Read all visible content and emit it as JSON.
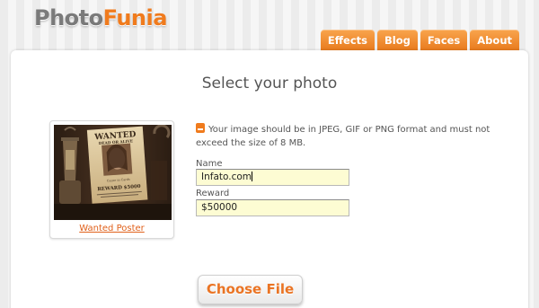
{
  "header": {
    "logo_part1": "Photo",
    "logo_part2": "Funia",
    "nav": [
      "Effects",
      "Blog",
      "Faces",
      "About"
    ]
  },
  "page": {
    "title": "Select your photo",
    "info_icon": "image-icon",
    "info_text": "Your image should be in JPEG, GIF or PNG format and must not exceed the size of 8 MB.",
    "effect_thumbnail": {
      "link_label": "Wanted Poster",
      "poster_wanted": "WANTED",
      "poster_dead_or_alive": "DEAD OR ALIVE",
      "poster_caption": "Cause in Cards",
      "poster_reward": "REWARD $5000"
    },
    "fields": [
      {
        "label": "Name",
        "value": "Infato.com"
      },
      {
        "label": "Reward",
        "value": "$50000"
      }
    ],
    "choose_file_label": "Choose File"
  },
  "colors": {
    "accent": "#f07b1d",
    "field_background": "#fdfcd3",
    "logo_grey": "#7a7a7a"
  }
}
